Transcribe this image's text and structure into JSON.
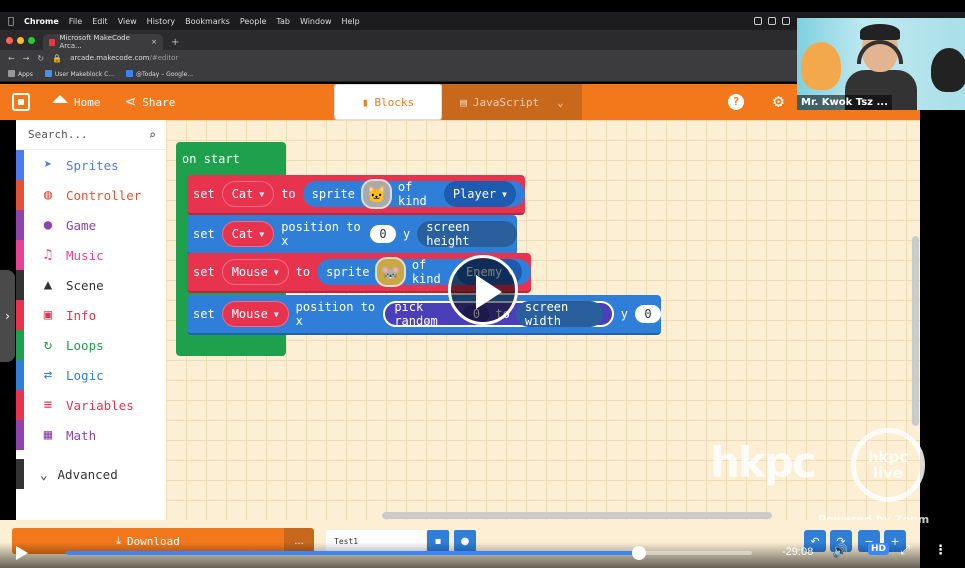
{
  "menubar": {
    "app": "Chrome",
    "items": [
      "File",
      "Edit",
      "View",
      "History",
      "Bookmarks",
      "People",
      "Tab",
      "Window",
      "Help"
    ]
  },
  "browser": {
    "tab_title": "Microsoft MakeCode Arca...",
    "new_tab": "+",
    "url_host": "arcade.makecode.com",
    "url_path": "/#editor",
    "bookmarks": [
      "Apps",
      "User Makeblock C...",
      "@Today – Google..."
    ]
  },
  "header": {
    "home_label": "Home",
    "share_label": "Share",
    "blocks_label": "Blocks",
    "js_label": "JavaScript",
    "help_icon_text": "?",
    "accent": "#f3781c"
  },
  "toolbox": {
    "search_placeholder": "Search...",
    "categories": [
      {
        "label": "Sprites",
        "color": "#4b7bec",
        "icon": "paper-plane-icon"
      },
      {
        "label": "Controller",
        "color": "#e55039",
        "icon": "gamepad-icon"
      },
      {
        "label": "Game",
        "color": "#8e44ad",
        "icon": "circle-icon"
      },
      {
        "label": "Music",
        "color": "#e84393",
        "icon": "headphones-icon"
      },
      {
        "label": "Scene",
        "color": "#333333",
        "icon": "tree-icon"
      },
      {
        "label": "Info",
        "color": "#e8334f",
        "icon": "id-card-icon"
      },
      {
        "label": "Loops",
        "color": "#1fa04c",
        "icon": "loop-icon"
      },
      {
        "label": "Logic",
        "color": "#2f7fd9",
        "icon": "shuffle-icon"
      },
      {
        "label": "Variables",
        "color": "#e8334f",
        "icon": "list-icon"
      },
      {
        "label": "Math",
        "color": "#8e44ad",
        "icon": "calculator-icon"
      }
    ],
    "advanced_label": "Advanced"
  },
  "blocks": {
    "on_start": "on start",
    "row1": {
      "set": "set",
      "var": "Cat",
      "to": "to",
      "sprite": "sprite",
      "of_kind": "of kind",
      "kind": "Player"
    },
    "row2": {
      "set": "set",
      "var": "Cat",
      "position": "position to x",
      "x": "0",
      "y": "y",
      "y_val": "screen height"
    },
    "row3": {
      "set": "set",
      "var": "Mouse",
      "to": "to",
      "sprite": "sprite",
      "of_kind": "of kind",
      "kind": "Enemy"
    },
    "row4": {
      "set": "set",
      "var": "Mouse",
      "position": "position to x",
      "pick": "pick random",
      "from": "0",
      "to": "to",
      "max": "screen width",
      "y": "y",
      "y_val": "0"
    }
  },
  "watermark": {
    "brand": "hkpc",
    "live_top": "hkpc",
    "live_bottom": "live",
    "powered": "Powered by Zoom"
  },
  "webcam": {
    "name": "Mr. Kwok Tsz ..."
  },
  "bottom": {
    "download_label": "Download",
    "more_label": "...",
    "project_name": "Test1"
  },
  "player": {
    "time_remaining": "-29:08",
    "progress_fraction": 0.837,
    "quality": "HD"
  }
}
